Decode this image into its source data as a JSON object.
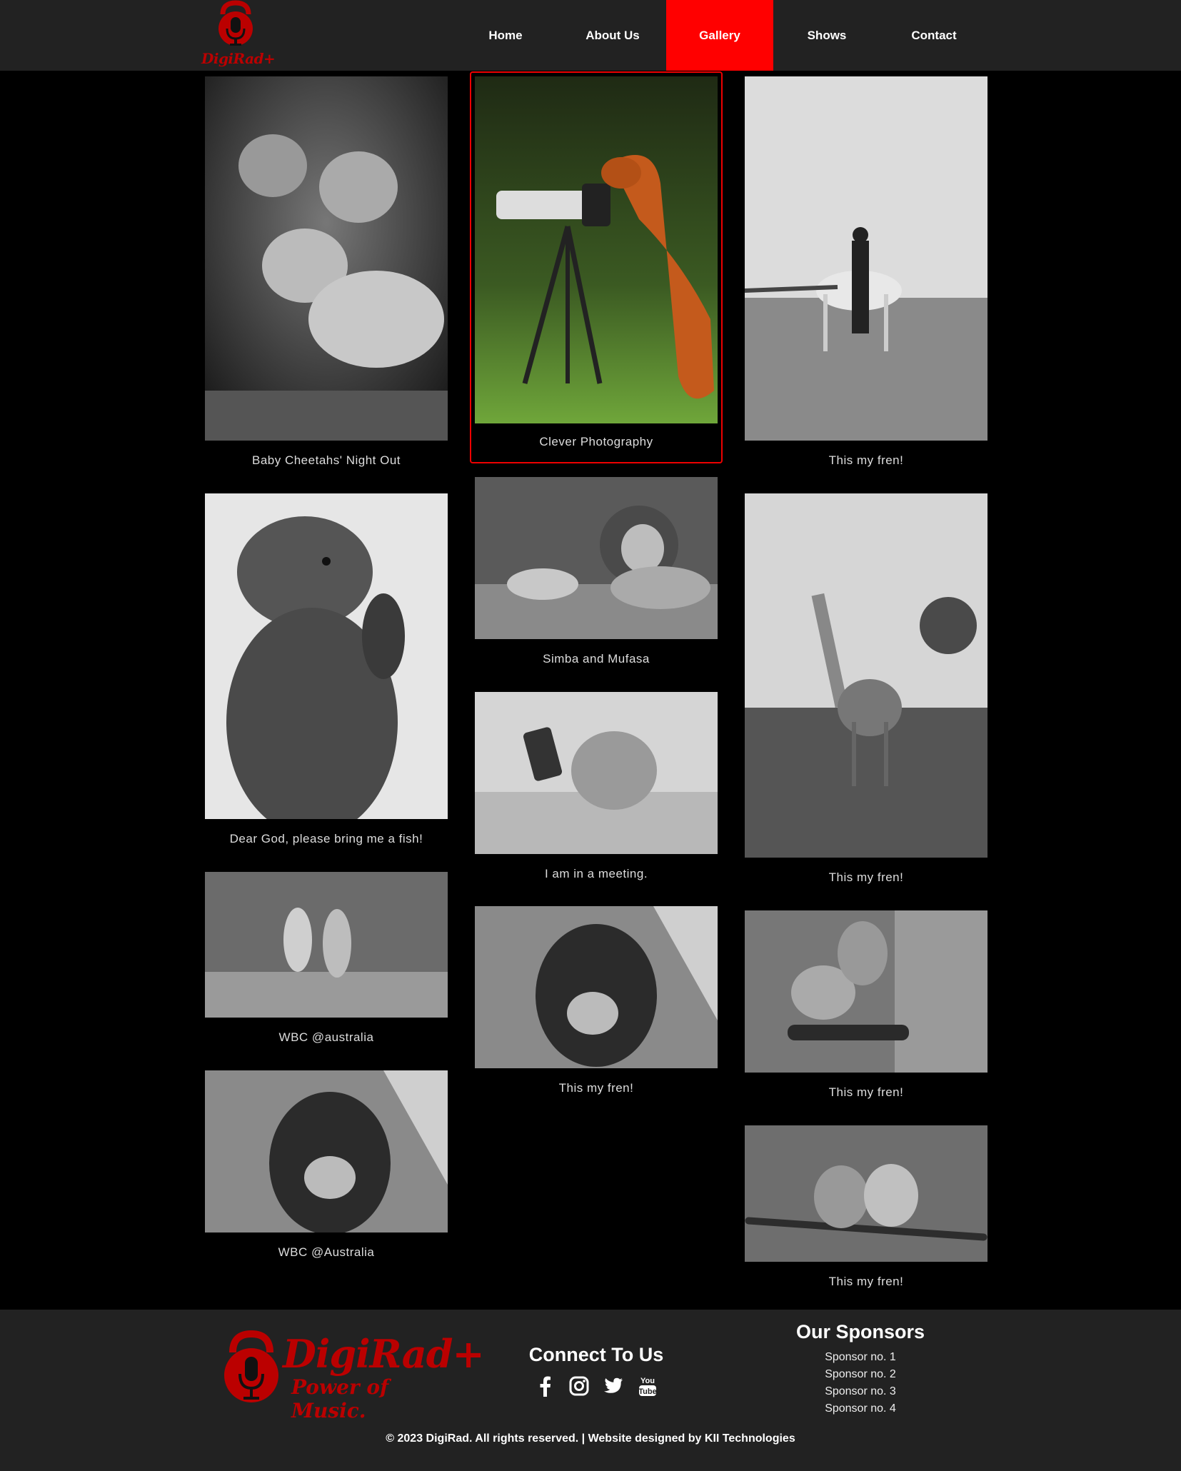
{
  "brand": {
    "name": "DigiRad+",
    "tagline": "Power of Music.",
    "logo_icon": "kettlebell-microphone-icon",
    "accent_color": "#ff0000"
  },
  "nav": {
    "items": [
      {
        "label": "Home",
        "active": false
      },
      {
        "label": "About Us",
        "active": false
      },
      {
        "label": "Gallery",
        "active": true
      },
      {
        "label": "Shows",
        "active": false
      },
      {
        "label": "Contact",
        "active": false
      }
    ]
  },
  "gallery": {
    "items": [
      {
        "caption": "Baby Cheetahs' Night Out",
        "subject": "cheetah-cubs-photo"
      },
      {
        "caption": "Clever Photography",
        "subject": "fox-with-camera-photo"
      },
      {
        "caption": "This my fren!",
        "subject": "man-with-horse-photo"
      },
      {
        "caption": "Dear God, please bring me a fish!",
        "subject": "otter-praying-photo"
      },
      {
        "caption": "Simba and Mufasa",
        "subject": "lions-resting-photo"
      },
      {
        "caption": "This my fren!",
        "subject": "giraffes-photo"
      },
      {
        "caption": "I am in a meeting.",
        "subject": "monkey-with-phone-photo"
      },
      {
        "caption": "WBC @australia",
        "subject": "kangaroos-boxing-photo"
      },
      {
        "caption": "This my fren!",
        "subject": "dog-closeup-photo"
      },
      {
        "caption": "This my fren!",
        "subject": "squirrel-on-feeder-photo"
      },
      {
        "caption": "WBC @Australia",
        "subject": "dog-closeup-photo-2"
      },
      {
        "caption": "This my fren!",
        "subject": "birds-kissing-photo"
      }
    ]
  },
  "footer": {
    "connect_title": "Connect To Us",
    "social": [
      "facebook-icon",
      "instagram-icon",
      "twitter-icon",
      "youtube-icon"
    ],
    "sponsors_title": "Our Sponsors",
    "sponsors": [
      "Sponsor no. 1",
      "Sponsor no. 2",
      "Sponsor no. 3",
      "Sponsor no. 4"
    ],
    "copyright": "© 2023 DigiRad. All rights reserved. | Website designed by KII Technologies"
  }
}
